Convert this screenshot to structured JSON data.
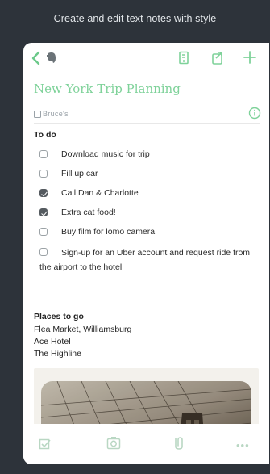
{
  "header": {
    "tagline": "Create and edit text notes with style"
  },
  "toolbar": {
    "back_icon": "chevron-left-icon",
    "app_icon": "elephant-icon",
    "reminder_icon": "reminder-icon",
    "share_icon": "share-icon",
    "add_icon": "plus-icon"
  },
  "note": {
    "title": "New York Trip Planning",
    "notebook": "Bruce's",
    "todo_heading": "To do",
    "todos": [
      {
        "text": "Download music for trip",
        "checked": false
      },
      {
        "text": "Fill up car",
        "checked": false
      },
      {
        "text": "Call Dan & Charlotte",
        "checked": true
      },
      {
        "text": "Extra cat food!",
        "checked": true
      },
      {
        "text": "Buy film for lomo camera",
        "checked": false
      },
      {
        "text": "Sign-up for an Uber account and request ride from the airport to the hotel",
        "checked": false
      }
    ],
    "places_heading": "Places to go",
    "places": [
      "Flea Market, Williamsburg",
      "Ace Hotel",
      "The Highline"
    ]
  },
  "bottom_bar": {
    "icons": [
      "checkbox-icon",
      "camera-icon",
      "attachment-icon",
      "more-icon"
    ],
    "more_label": "•••"
  },
  "colors": {
    "accent": "#6cc98a",
    "background": "#2d333a",
    "checked_box": "#555b60"
  }
}
